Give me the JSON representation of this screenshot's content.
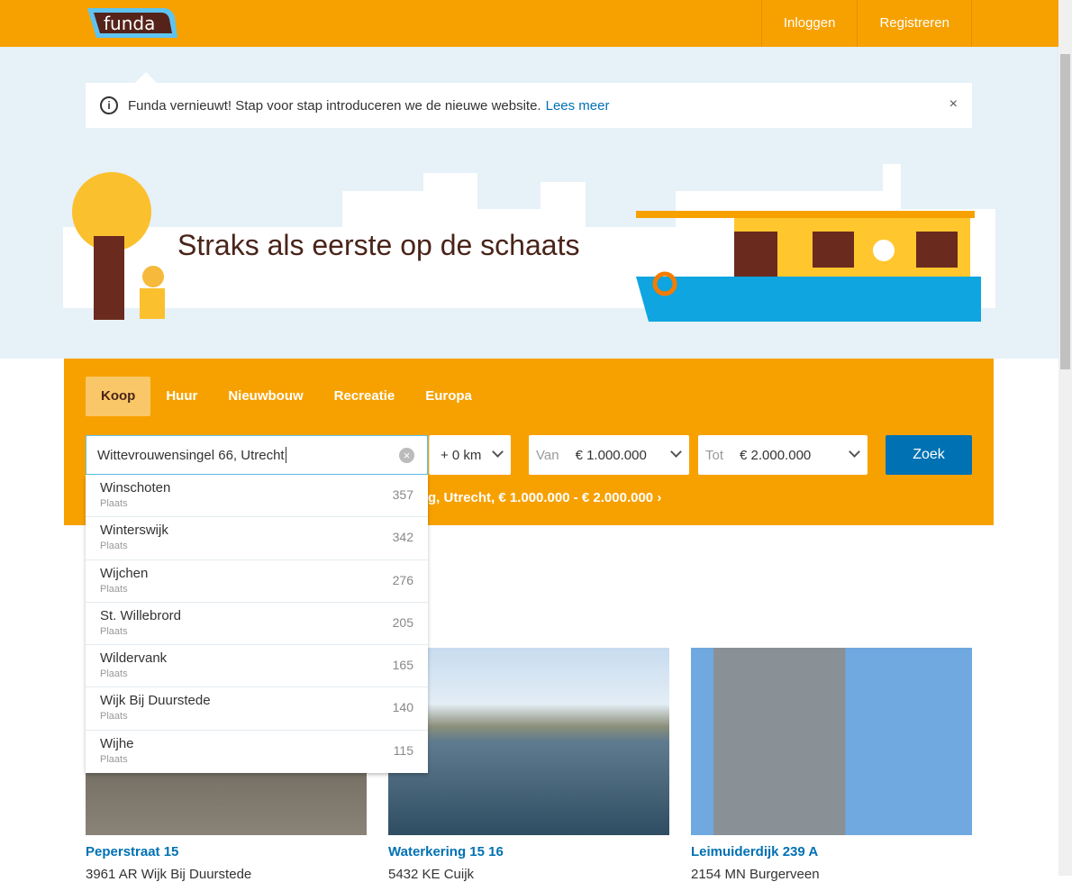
{
  "header": {
    "logo": "funda",
    "nav": [
      "Inloggen",
      "Registreren"
    ]
  },
  "notice": {
    "text": "Funda vernieuwt! Stap voor stap introduceren we de nieuwe website.",
    "link": "Lees meer",
    "close": "×"
  },
  "hero": {
    "title": "Straks als eerste op de schaats"
  },
  "search": {
    "tabs": [
      "Koop",
      "Huur",
      "Nieuwbouw",
      "Recreatie",
      "Europa"
    ],
    "active_tab": "Koop",
    "query": "Wittevrouwensingel 66, Utrecht",
    "radius": "+ 0 km",
    "from_label": "Van",
    "from_value": "€ 1.000.000",
    "to_label": "Tot",
    "to_value": "€ 2.000.000",
    "submit": "Zoek",
    "recent": "g, Utrecht, € 1.000.000 - € 2.000.000"
  },
  "suggestions": [
    {
      "name": "Winschoten",
      "type": "Plaats",
      "count": "357"
    },
    {
      "name": "Winterswijk",
      "type": "Plaats",
      "count": "342"
    },
    {
      "name": "Wijchen",
      "type": "Plaats",
      "count": "276"
    },
    {
      "name": "St. Willebrord",
      "type": "Plaats",
      "count": "205"
    },
    {
      "name": "Wildervank",
      "type": "Plaats",
      "count": "165"
    },
    {
      "name": "Wijk Bij Duurstede",
      "type": "Plaats",
      "count": "140"
    },
    {
      "name": "Wijhe",
      "type": "Plaats",
      "count": "115"
    }
  ],
  "listings": [
    {
      "address": "Peperstraat 15",
      "city": "3961 AR Wijk Bij Duurstede"
    },
    {
      "address": "Waterkering 15 16",
      "city": "5432 KE Cuijk"
    },
    {
      "address": "Leimuiderdijk 239 A",
      "city": "2154 MN Burgerveen"
    }
  ],
  "colors": {
    "brand": "#f7a100",
    "link": "#0071b3",
    "hero_bg": "#e6f1f8"
  }
}
